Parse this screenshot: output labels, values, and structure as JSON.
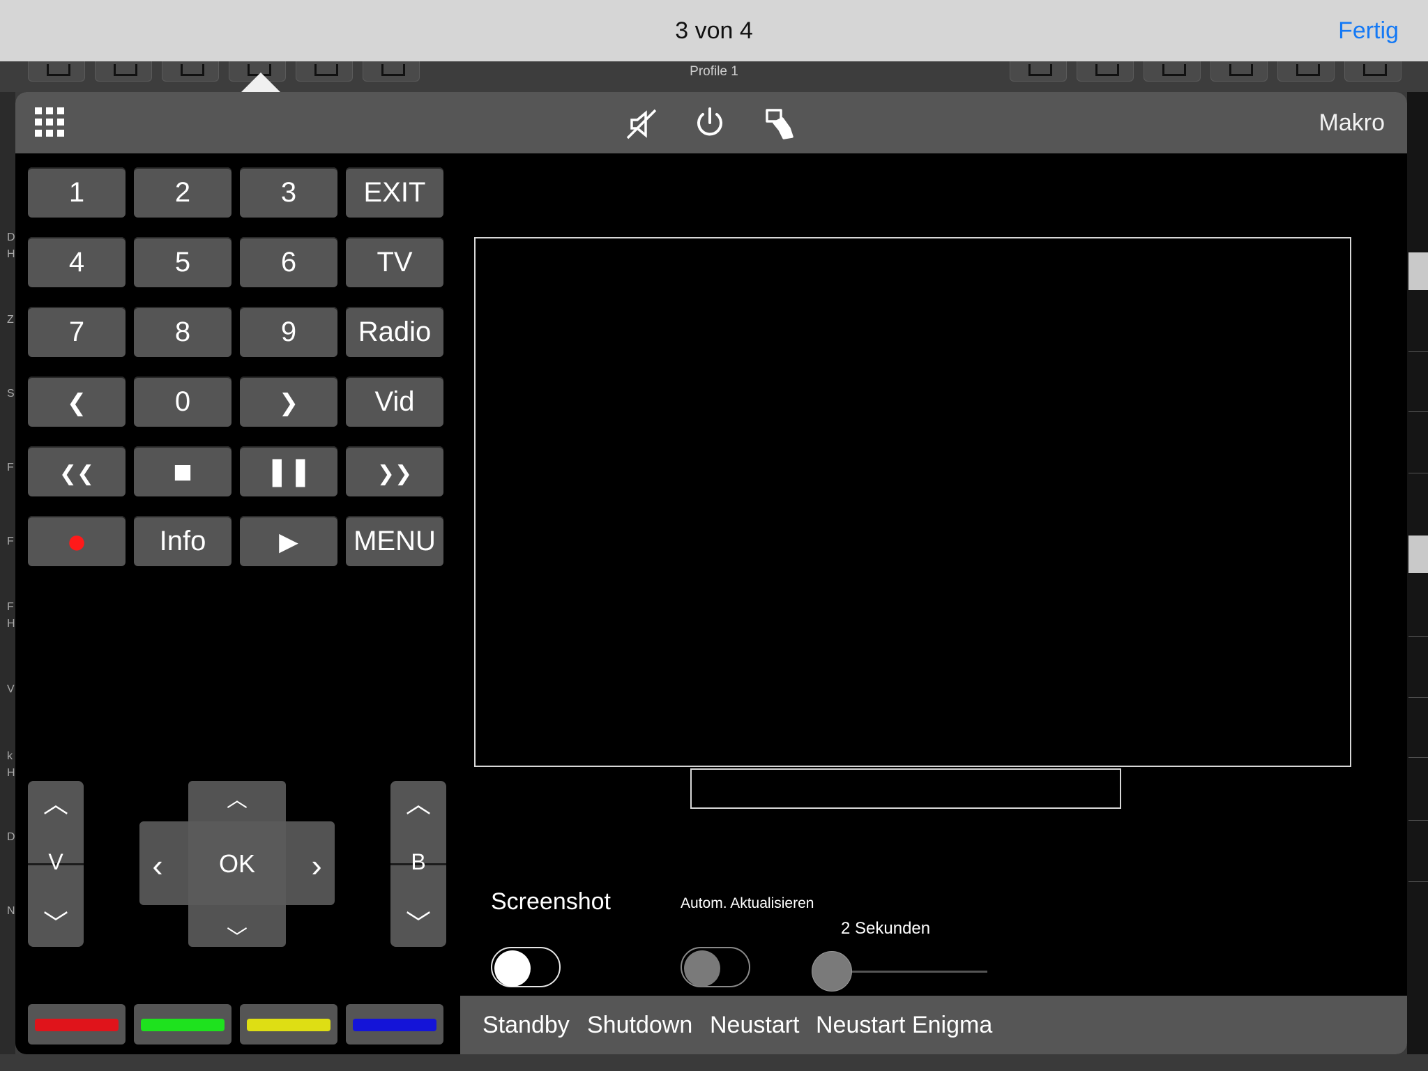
{
  "topbar": {
    "pager": "3 von 4",
    "done": "Fertig"
  },
  "bg": {
    "profile": "Profile 1",
    "side_letters": [
      "D",
      "H",
      "Z",
      "S",
      "F",
      "F",
      "F",
      "H",
      "V",
      "k",
      "H",
      "D",
      "N"
    ]
  },
  "header": {
    "makro": "Makro"
  },
  "keypad": {
    "rows": [
      [
        "1",
        "2",
        "3",
        "EXIT"
      ],
      [
        "4",
        "5",
        "6",
        "TV"
      ],
      [
        "7",
        "8",
        "9",
        "Radio"
      ],
      [
        "❮",
        "0",
        "❯",
        "Vid"
      ],
      [
        "❮❮",
        "■",
        "❚❚",
        "❯❯"
      ],
      [
        "●",
        "Info",
        "▶",
        "MENU"
      ]
    ]
  },
  "dpad": {
    "ok": "OK",
    "up": "︿",
    "down": "﹀",
    "left": "‹",
    "right": "›"
  },
  "volume": {
    "label": "V",
    "up": "︿",
    "down": "﹀"
  },
  "bouquet": {
    "label": "B",
    "up": "︿",
    "down": "﹀"
  },
  "colors": {
    "red": "#e0141b",
    "green": "#1ee21e",
    "yellow": "#dede14",
    "blue": "#1414d8",
    "record": "#ff1a1a",
    "accent": "#1479f5"
  },
  "screenshot": {
    "label": "Screenshot",
    "enabled": true
  },
  "auto_refresh": {
    "label": "Autom. Aktualisieren",
    "enabled": false,
    "interval_label": "2 Sekunden",
    "slider_value": 0
  },
  "bottom": {
    "standby": "Standby",
    "shutdown": "Shutdown",
    "restart": "Neustart",
    "restart_enigma": "Neustart Enigma"
  }
}
